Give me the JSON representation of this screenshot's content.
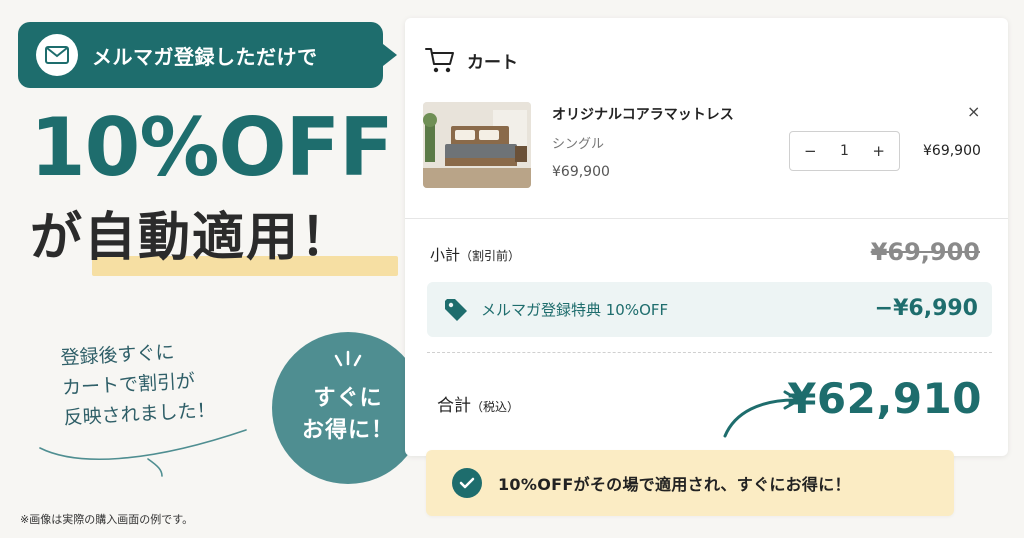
{
  "promo": {
    "bubble_text": "メルマガ登録しただけで",
    "mail_icon": "mail-icon",
    "headline_discount": "10%OFF",
    "headline_apply": "が自動適用！",
    "hand_note": [
      "登録後すぐに",
      "カートで割引が",
      "反映されました！"
    ],
    "badge_lines": [
      "すぐに",
      "お得に！"
    ],
    "footnote": "※画像は実際の購入画面の例です。"
  },
  "cart": {
    "title": "カート",
    "cart_icon": "cart-icon",
    "item": {
      "name": "オリジナルコアラマットレス",
      "variant": "シングル",
      "unit_price": "¥69,900",
      "quantity": "1",
      "minus_label": "−",
      "plus_label": "+",
      "line_total": "¥69,900",
      "remove_label": "×"
    },
    "subtotal": {
      "label": "小計",
      "label_note": "（割引前）",
      "value": "¥69,900"
    },
    "discount": {
      "label": "メルマガ登録特典 10%OFF",
      "value": "−¥6,990",
      "icon": "tag-icon"
    },
    "total": {
      "label": "合計",
      "label_note": "（税込）",
      "value": "¥62,910"
    }
  },
  "banner": {
    "text": "10%OFFがその場で適用され、すぐにお得に！",
    "icon": "check-circle-icon"
  },
  "colors": {
    "brand_teal": "#1e6d6d",
    "badge_teal": "#4f8e91",
    "highlight_yellow": "#f6dfa3",
    "banner_yellow": "#fbecc4",
    "discount_bg": "#edf4f4"
  }
}
